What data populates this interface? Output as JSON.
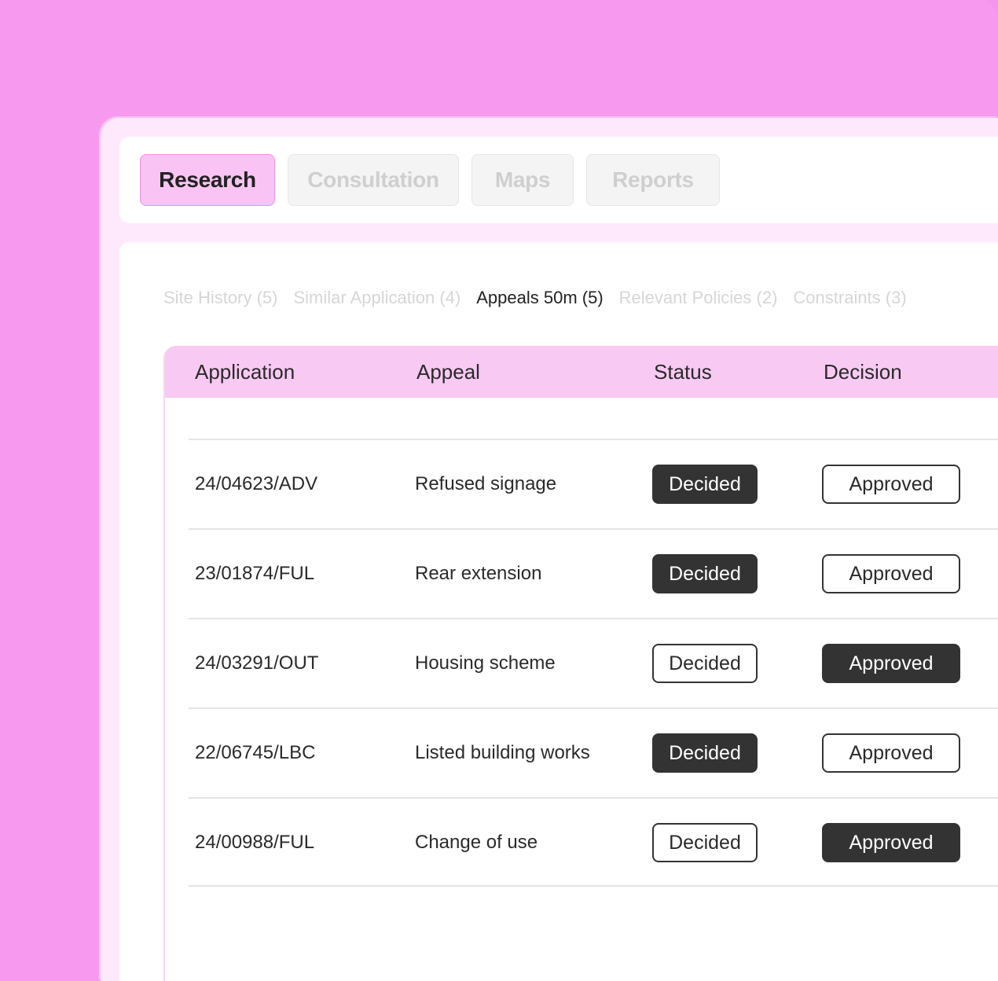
{
  "tabs": [
    {
      "label": "Research",
      "active": true
    },
    {
      "label": "Consultation",
      "active": false
    },
    {
      "label": "Maps",
      "active": false
    },
    {
      "label": "Reports",
      "active": false
    }
  ],
  "subtabs": [
    {
      "label": "Site History (5)",
      "active": false
    },
    {
      "label": "Similar Application (4)",
      "active": false
    },
    {
      "label": "Appeals 50m (5)",
      "active": true
    },
    {
      "label": "Relevant Policies (2)",
      "active": false
    },
    {
      "label": "Constraints (3)",
      "active": false
    }
  ],
  "table": {
    "headers": {
      "application": "Application",
      "appeal": "Appeal",
      "status": "Status",
      "decision": "Decision"
    },
    "rows": [
      {
        "application": "24/04623/ADV",
        "appeal": "Refused signage",
        "status": "Decided",
        "status_style": "dark",
        "decision": "Approved",
        "decision_style": "light"
      },
      {
        "application": "23/01874/FUL",
        "appeal": "Rear extension",
        "status": "Decided",
        "status_style": "dark",
        "decision": "Approved",
        "decision_style": "light"
      },
      {
        "application": "24/03291/OUT",
        "appeal": "Housing scheme",
        "status": "Decided",
        "status_style": "light",
        "decision": "Approved",
        "decision_style": "dark"
      },
      {
        "application": "22/06745/LBC",
        "appeal": "Listed building works",
        "status": "Decided",
        "status_style": "dark",
        "decision": "Approved",
        "decision_style": "light"
      },
      {
        "application": "24/00988/FUL",
        "appeal": "Change of use",
        "status": "Decided",
        "status_style": "light",
        "decision": "Approved",
        "decision_style": "dark"
      }
    ]
  },
  "colors": {
    "background": "#f596ee",
    "accent": "#f9c4f3",
    "accent_border": "#f192e6",
    "pill_dark": "#333333"
  }
}
